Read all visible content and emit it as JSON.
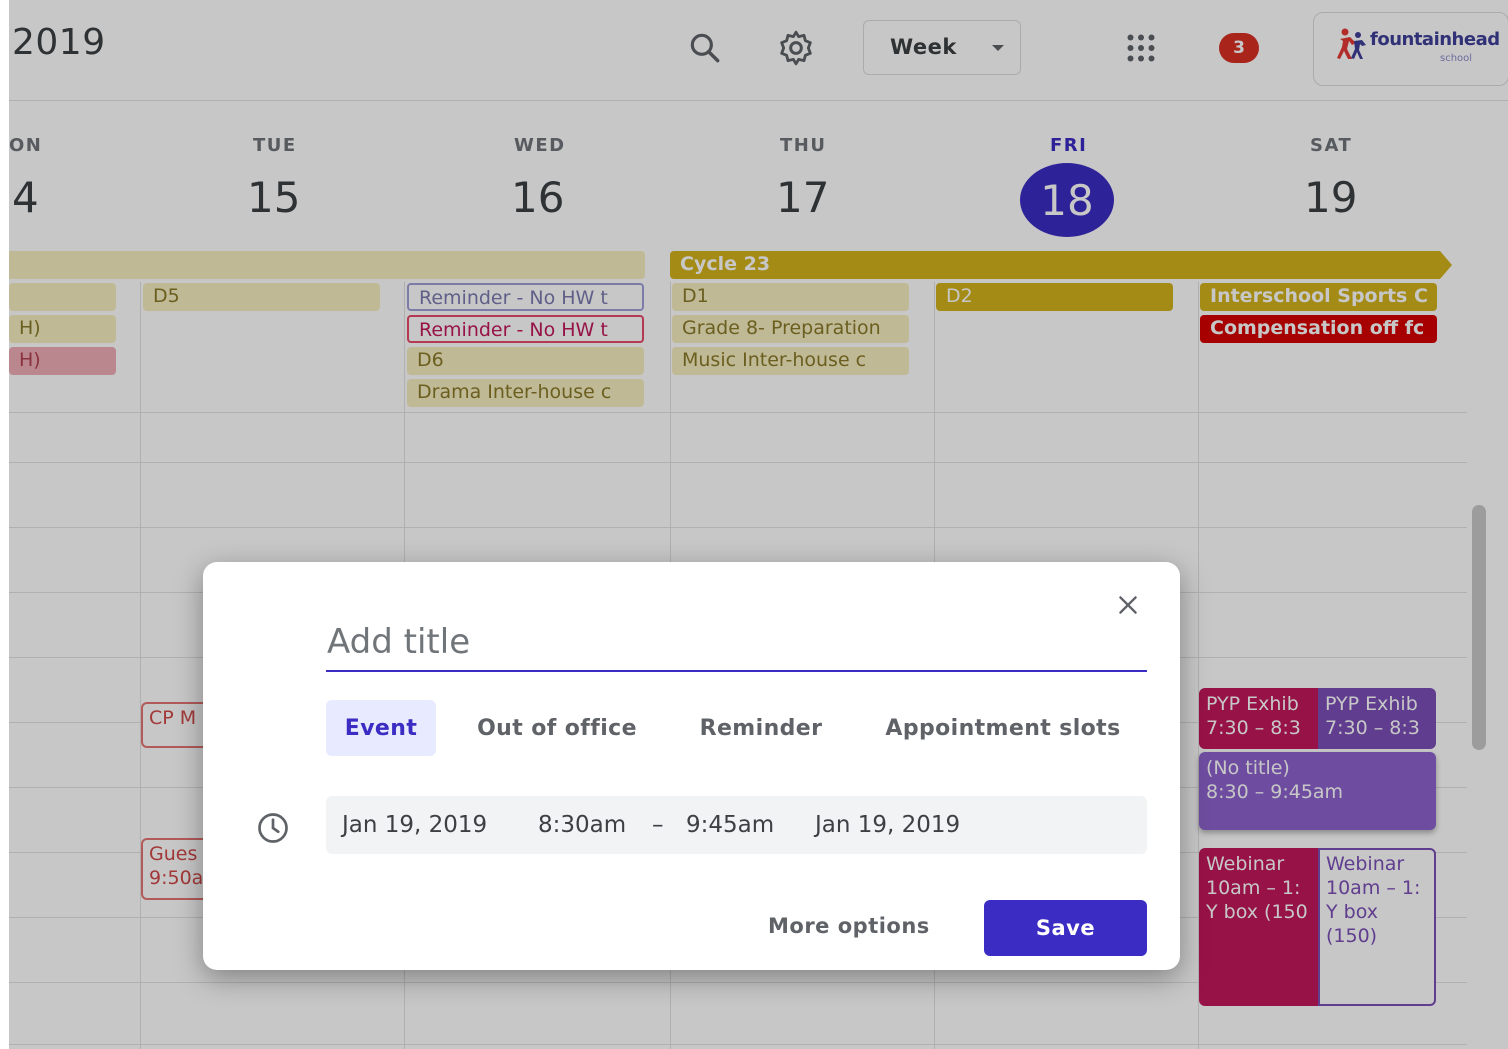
{
  "header": {
    "year": "2019",
    "view": "Week",
    "notifications": "3",
    "logo_text": "fountainhead",
    "logo_sub": "school"
  },
  "days": [
    {
      "dow": "ON",
      "num": "4"
    },
    {
      "dow": "TUE",
      "num": "15"
    },
    {
      "dow": "WED",
      "num": "16"
    },
    {
      "dow": "THU",
      "num": "17"
    },
    {
      "dow": "FRI",
      "num": "18"
    },
    {
      "dow": "SAT",
      "num": "19"
    }
  ],
  "allday": {
    "cycle": "Cycle 23",
    "mon_1": "H)",
    "mon_2": "H)",
    "tue_1": "D5",
    "wed_1": "Reminder - No HW t",
    "wed_2": "Reminder - No HW t",
    "wed_3": "D6",
    "wed_4": "Drama Inter-house c",
    "thu_1": "D1",
    "thu_2": "Grade 8- Preparation",
    "thu_3": "Music Inter-house c",
    "fri_1": "D2",
    "sat_1": "Interschool Sports C",
    "sat_2": "Compensation off fc"
  },
  "timed": {
    "tue_cp": "CP M",
    "tue_guest_1": "Gues",
    "tue_guest_2": "9:50a",
    "pyp1_title": "PYP Exhib",
    "pyp1_time": "7:30 – 8:3",
    "pyp2_title": "PYP Exhib",
    "pyp2_time": "7:30 – 8:3",
    "notitle_title": "(No title)",
    "notitle_time": "8:30 – 9:45am",
    "web1_title": "Webinar",
    "web1_time": "10am – 1:",
    "web1_loc": "Y box (150",
    "web2_title": "Webinar",
    "web2_time": "10am – 1:",
    "web2_loc": "Y box",
    "web2_loc2": "(150)"
  },
  "dialog": {
    "title_placeholder": "Add title",
    "tabs": [
      "Event",
      "Out of office",
      "Reminder",
      "Appointment slots"
    ],
    "start_date": "Jan 19, 2019",
    "start_time": "8:30am",
    "dash": "–",
    "end_time": "9:45am",
    "end_date": "Jan 19, 2019",
    "more_options": "More options",
    "save": "Save"
  },
  "colors": {
    "accent": "#3b2cc4",
    "cycle": "#d2b31c",
    "badge": "#d93025",
    "event_red": "#c2185b",
    "event_purple": "#8e63ce"
  }
}
